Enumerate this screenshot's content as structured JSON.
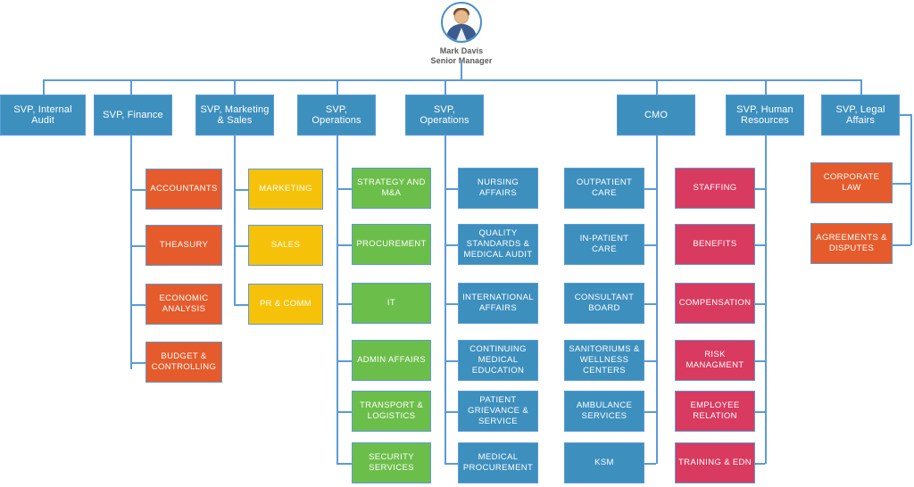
{
  "root": {
    "avatar_icon": "user-avatar-icon",
    "name": "Mark Davis",
    "title": "Senior Manager"
  },
  "departments": [
    {
      "id": "internal-audit",
      "label": "SVP, Internal Audit"
    },
    {
      "id": "finance",
      "label": "SVP, Finance"
    },
    {
      "id": "marketing-sales",
      "label": "SVP, Marketing & Sales"
    },
    {
      "id": "operations-1",
      "label": "SVP, Operations"
    },
    {
      "id": "operations-2",
      "label": "SVP, Operations"
    },
    {
      "id": "cmo",
      "label": "CMO"
    },
    {
      "id": "human-resources",
      "label": "SVP, Human Resources"
    },
    {
      "id": "legal-affairs",
      "label": "SVP, Legal Affairs"
    }
  ],
  "columns": {
    "finance": {
      "color": "#E55B2B",
      "items": [
        "ACCOUNTANTS",
        "THEASURY",
        "ECONOMIC ANALYSIS",
        "BUDGET & CONTROLLING"
      ]
    },
    "marketing_sales": {
      "color": "#F6C209",
      "items": [
        "MARKETING",
        "SALES",
        "PR & COMM"
      ]
    },
    "operations_1": {
      "color": "#6CBE4A",
      "items": [
        "STRATEGY AND M&A",
        "PROCUREMENT",
        "IT",
        "ADMIN AFFAIRS",
        "TRANSPORT & LOGISTICS",
        "SECURITY SERVICES"
      ]
    },
    "operations_2": {
      "color": "#3D8FBE",
      "items": [
        "NURSING AFFAIRS",
        "QUALITY STANDARDS & MEDICAL AUDIT",
        "INTERNATIONAL AFFAIRS",
        "CONTINUING MEDICAL EDUCATION",
        "PATIENT GRIEVANCE & SERVICE",
        "MEDICAL PROCUREMENT"
      ]
    },
    "cmo": {
      "color": "#3D8FBE",
      "items": [
        "OUTPATIENT CARE",
        "IN-PATIENT CARE",
        "CONSULTANT BOARD",
        "SANITORIUMS & WELLNESS CENTERS",
        "AMBULANCE SERVICES",
        "KSM"
      ]
    },
    "human_resources": {
      "color": "#D93A5F",
      "items": [
        "STAFFING",
        "BENEFITS",
        "COMPENSATION",
        "RISK MANAGMENT",
        "EMPLOYEE RELATION",
        "TRAINING & EDN"
      ]
    },
    "legal_affairs": {
      "color": "#E55B2B",
      "items": [
        "CORPORATE LAW",
        "AGREEMENTS & DISPUTES"
      ]
    }
  },
  "theme": {
    "connector_color": "#5B9BD5",
    "department_color": "#3D8FBE",
    "background": "#FFFFFF"
  }
}
